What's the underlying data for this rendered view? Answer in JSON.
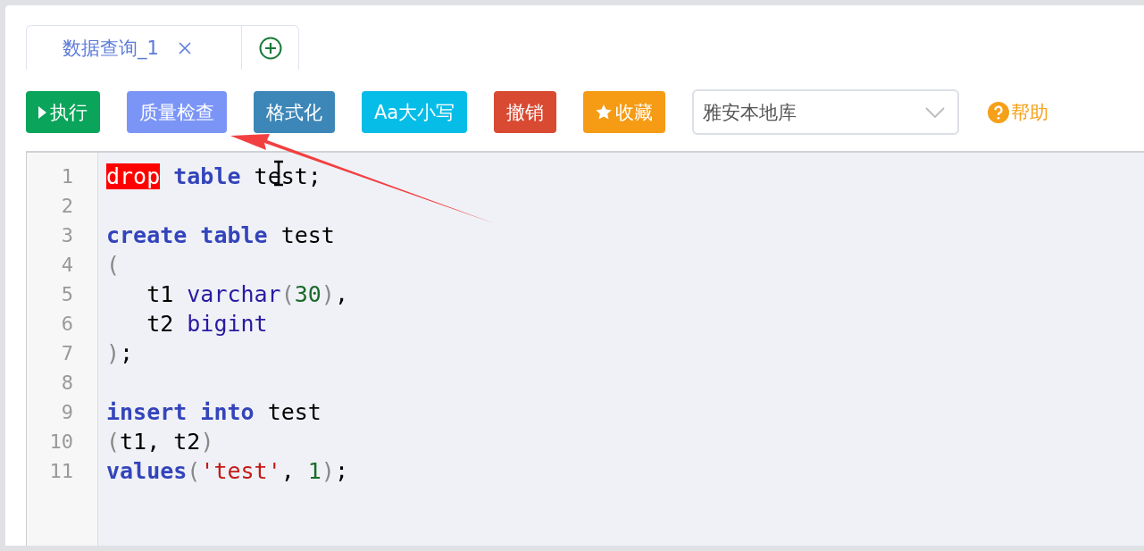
{
  "tabs": [
    {
      "label": "数据查询_1",
      "selected": true
    },
    {
      "kind": "add",
      "selected": false
    }
  ],
  "toolbar": {
    "buttons": [
      {
        "label": "执行",
        "kind": "play",
        "color": "#0aa45a"
      },
      {
        "label": "质量检查",
        "color": "#7b95f7"
      },
      {
        "label": "格式化",
        "color": "#3d87b8"
      },
      {
        "label": "Aa大小写",
        "color": "#06bde8"
      },
      {
        "label": "撤销",
        "color": "#d94a33"
      },
      {
        "label": "收藏",
        "kind": "star",
        "color": "#f59b14"
      }
    ],
    "database_select": {
      "value": "雅安本地库"
    },
    "help": {
      "label": "帮助"
    }
  },
  "editor": {
    "lines": [
      {
        "number": "1",
        "tokens": [
          {
            "kind": "error",
            "text": "drop"
          },
          {
            "kind": "keyword",
            "text": " table"
          },
          {
            "kind": "plain",
            "text": " test;"
          }
        ]
      },
      {
        "number": "2"
      },
      {
        "number": "3",
        "tokens": [
          {
            "kind": "keyword",
            "text": "create table"
          },
          {
            "kind": "plain",
            "text": " test"
          }
        ]
      },
      {
        "number": "4",
        "tokens": [
          {
            "kind": "bracket",
            "text": "("
          }
        ]
      },
      {
        "number": "5",
        "tokens": [
          {
            "kind": "plain",
            "text": "   t1 "
          },
          {
            "kind": "type",
            "text": "varchar"
          },
          {
            "kind": "bracket",
            "text": "("
          },
          {
            "kind": "number",
            "text": "30"
          },
          {
            "kind": "bracket",
            "text": ")"
          },
          {
            "kind": "plain",
            "text": ","
          }
        ]
      },
      {
        "number": "6",
        "tokens": [
          {
            "kind": "plain",
            "text": "   t2 "
          },
          {
            "kind": "type",
            "text": "bigint"
          }
        ]
      },
      {
        "number": "7",
        "tokens": [
          {
            "kind": "bracket",
            "text": ")"
          },
          {
            "kind": "plain",
            "text": ";"
          }
        ]
      },
      {
        "number": "8"
      },
      {
        "number": "9",
        "tokens": [
          {
            "kind": "keyword",
            "text": "insert into"
          },
          {
            "kind": "plain",
            "text": " test"
          }
        ]
      },
      {
        "number": "10",
        "tokens": [
          {
            "kind": "bracket",
            "text": "("
          },
          {
            "kind": "plain",
            "text": "t1, t2"
          },
          {
            "kind": "bracket",
            "text": ")"
          }
        ]
      },
      {
        "number": "11",
        "tokens": [
          {
            "kind": "keyword",
            "text": "values"
          },
          {
            "kind": "bracket",
            "text": "("
          },
          {
            "kind": "string",
            "text": "'test'"
          },
          {
            "kind": "plain",
            "text": ", "
          },
          {
            "kind": "number",
            "text": "1"
          },
          {
            "kind": "bracket",
            "text": ")"
          },
          {
            "kind": "plain",
            "text": ";"
          }
        ]
      }
    ]
  }
}
